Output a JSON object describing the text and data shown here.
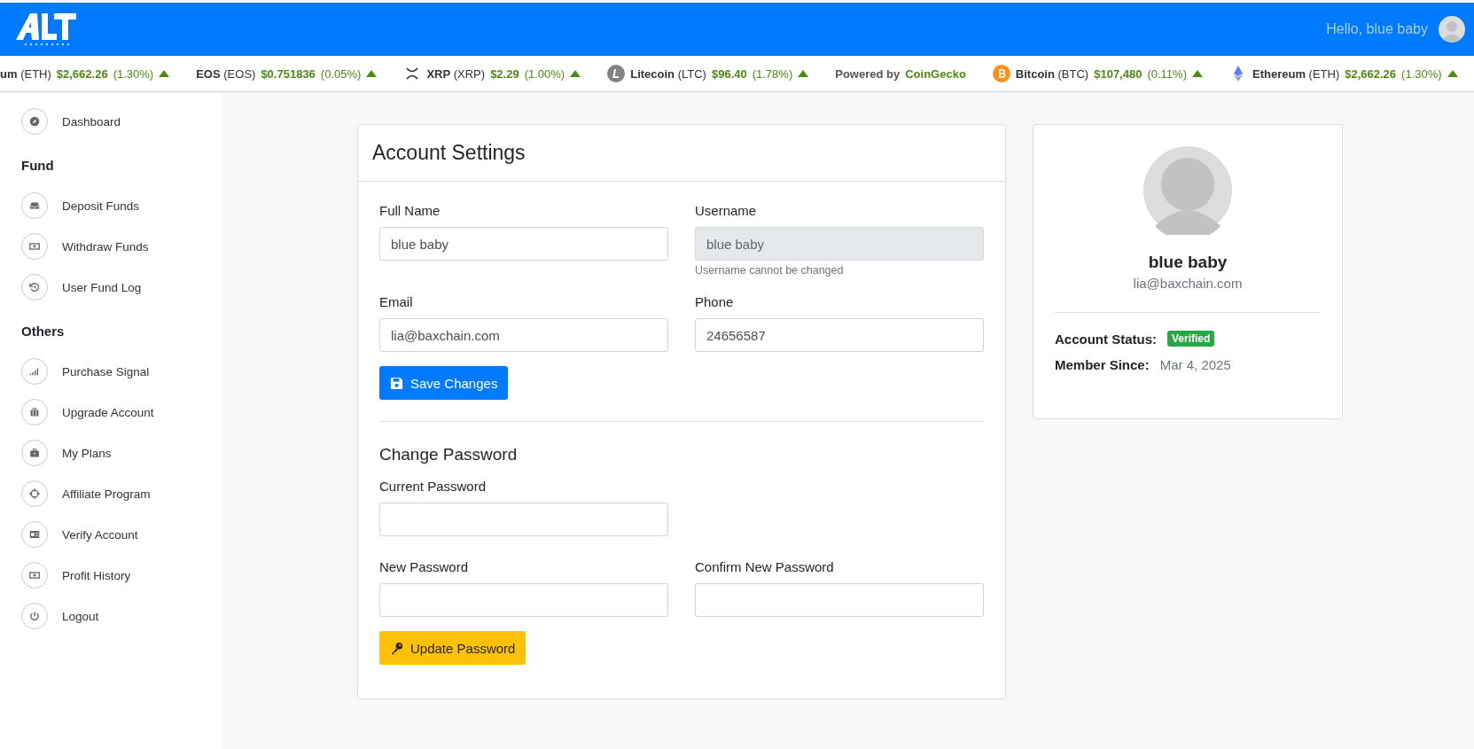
{
  "header": {
    "greeting": "Hello, blue baby"
  },
  "ticker": [
    {
      "kind": "coin",
      "name": "um",
      "symbol": "(ETH)",
      "price": "$2,662.26",
      "change": "(1.30%)"
    },
    {
      "kind": "coin",
      "name": "EOS",
      "symbol": "(EOS)",
      "price": "$0.751836",
      "change": "(0.05%)"
    },
    {
      "kind": "coin",
      "name": "XRP",
      "symbol": "(XRP)",
      "price": "$2.29",
      "change": "(1.00%)"
    },
    {
      "kind": "coin",
      "name": "Litecoin",
      "symbol": "(LTC)",
      "price": "$96.40",
      "change": "(1.78%)"
    },
    {
      "kind": "credit",
      "text": "Powered by",
      "link": "CoinGecko"
    },
    {
      "kind": "coin",
      "name": "Bitcoin",
      "symbol": "(BTC)",
      "price": "$107,480",
      "change": "(0.11%)"
    },
    {
      "kind": "coin",
      "name": "Ethereum",
      "symbol": "(ETH)",
      "price": "$2,662.26",
      "change": "(1.30%)"
    }
  ],
  "sidebar": {
    "sections": [
      {
        "items": [
          {
            "label": "Dashboard"
          }
        ]
      },
      {
        "heading": "Fund",
        "items": [
          {
            "label": "Deposit Funds"
          },
          {
            "label": "Withdraw Funds"
          },
          {
            "label": "User Fund Log"
          }
        ]
      },
      {
        "heading": "Others",
        "items": [
          {
            "label": "Purchase Signal"
          },
          {
            "label": "Upgrade Account"
          },
          {
            "label": "My Plans"
          },
          {
            "label": "Affiliate Program"
          },
          {
            "label": "Verify Account"
          },
          {
            "label": "Profit History"
          },
          {
            "label": "Logout"
          }
        ]
      }
    ]
  },
  "account_settings": {
    "title": "Account Settings",
    "profile_fields": [
      {
        "label": "Full Name",
        "value": "blue baby",
        "disabled": false
      },
      {
        "label": "Username",
        "value": "blue baby",
        "disabled": true,
        "hint": "Username cannot be changed"
      },
      {
        "label": "Email",
        "value": "lia@baxchain.com",
        "disabled": false
      },
      {
        "label": "Phone",
        "value": "24656587",
        "disabled": false
      }
    ],
    "save_button": "Save Changes",
    "password_title": "Change Password",
    "password_fields": [
      {
        "label": "Current Password"
      },
      {
        "label": "New Password"
      },
      {
        "label": "Confirm New Password"
      }
    ],
    "update_button": "Update Password"
  },
  "profile": {
    "name": "blue baby",
    "email": "lia@baxchain.com",
    "status_label": "Account Status:",
    "status": "Verified",
    "since_label": "Member Since:",
    "since": "Mar 4, 2025"
  }
}
